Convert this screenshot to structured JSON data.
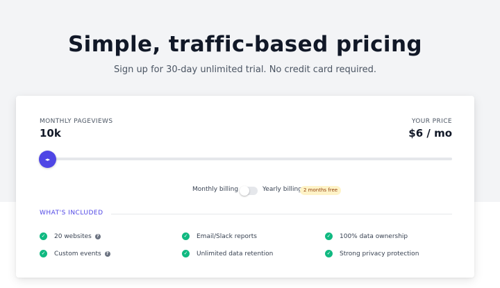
{
  "header": {
    "title": "Simple, traffic-based pricing",
    "subtitle": "Sign up for 30-day unlimited trial. No credit card required."
  },
  "pricing": {
    "pageviews_label": "MONTHLY PAGEVIEWS",
    "pageviews_value": "10k",
    "price_label": "YOUR PRICE",
    "price_value": "$6 / mo",
    "slider_level": 0,
    "monthly_billing_label": "Monthly billing",
    "yearly_billing_label": "Yearly billing",
    "yearly_badge": "2 months free",
    "billing_toggle_on": false
  },
  "included": {
    "heading": "WHAT'S INCLUDED",
    "features": [
      {
        "label": "20 websites",
        "help": true
      },
      {
        "label": "Email/Slack reports",
        "help": false
      },
      {
        "label": "100% data ownership",
        "help": false
      },
      {
        "label": "Custom events",
        "help": true
      },
      {
        "label": "Unlimited data retention",
        "help": false
      },
      {
        "label": "Strong privacy protection",
        "help": false
      }
    ]
  },
  "colors": {
    "accent": "#4f46e5",
    "check": "#10b981",
    "badge_bg": "#fef3c7",
    "top_bg": "#f3f4f6"
  },
  "icons": {
    "slider_thumb": "arrows-horizontal-icon",
    "check": "check-circle-icon",
    "help": "question-circle-icon"
  }
}
